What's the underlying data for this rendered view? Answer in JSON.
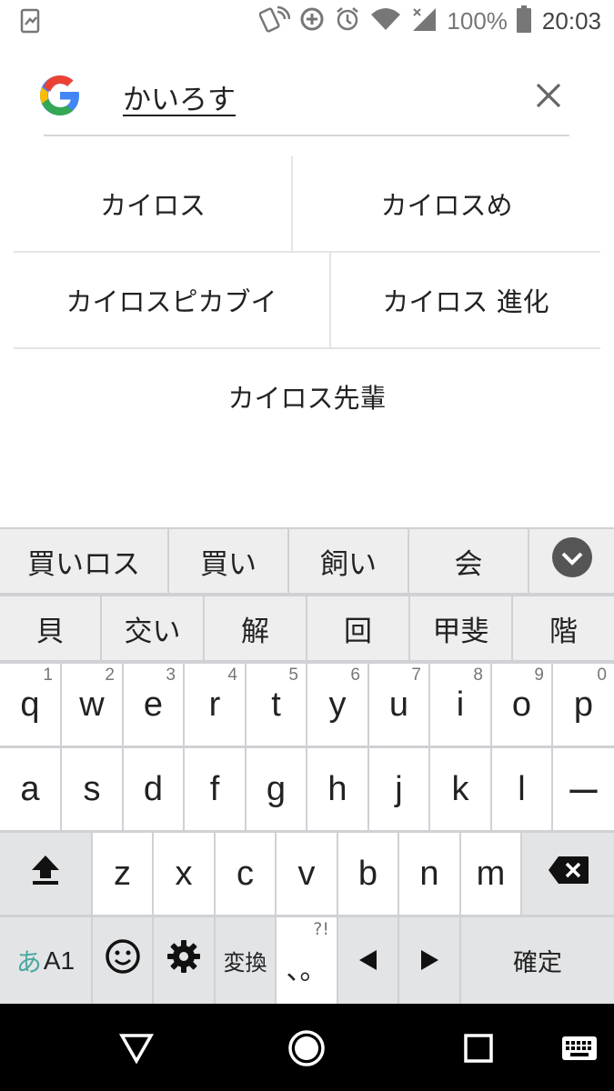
{
  "status_bar": {
    "battery_percent": "100%",
    "time": "20:03",
    "icons": [
      "screenshot-icon",
      "nfc-icon",
      "data-saver-icon",
      "alarm-icon",
      "wifi-icon",
      "cellular-signal-icon",
      "battery-icon"
    ]
  },
  "search": {
    "query": "かいろす",
    "logo": "google-logo-icon",
    "clear_icon": "close-icon"
  },
  "suggestions": {
    "rows": [
      [
        "カイロス",
        "カイロスめ"
      ],
      [
        "カイロスピカブイ",
        "カイロス 進化"
      ],
      [
        "カイロス先輩"
      ]
    ]
  },
  "keyboard": {
    "candidates_row1": [
      "買いロス",
      "買い",
      "飼い",
      "会"
    ],
    "candidates_row2": [
      "貝",
      "交い",
      "解",
      "回",
      "甲斐",
      "階"
    ],
    "expand_icon": "chevron-down-icon",
    "row1": [
      {
        "key": "q",
        "sub": "1"
      },
      {
        "key": "w",
        "sub": "2"
      },
      {
        "key": "e",
        "sub": "3"
      },
      {
        "key": "r",
        "sub": "4"
      },
      {
        "key": "t",
        "sub": "5"
      },
      {
        "key": "y",
        "sub": "6"
      },
      {
        "key": "u",
        "sub": "7"
      },
      {
        "key": "i",
        "sub": "8"
      },
      {
        "key": "o",
        "sub": "9"
      },
      {
        "key": "p",
        "sub": "0"
      }
    ],
    "row2": [
      "a",
      "s",
      "d",
      "f",
      "g",
      "h",
      "j",
      "k",
      "l",
      "ー"
    ],
    "row3": [
      "z",
      "x",
      "c",
      "v",
      "b",
      "n",
      "m"
    ],
    "mode_key": {
      "kana": "あ",
      "latin": "A1"
    },
    "convert_label": "変換",
    "punct_label": "、。",
    "punct_sub": "?!",
    "confirm_label": "確定",
    "accent_color": "#4aa8a0"
  },
  "nav_bar": {
    "icons": [
      "back-icon",
      "home-icon",
      "recents-icon",
      "keyboard-switch-icon"
    ]
  }
}
